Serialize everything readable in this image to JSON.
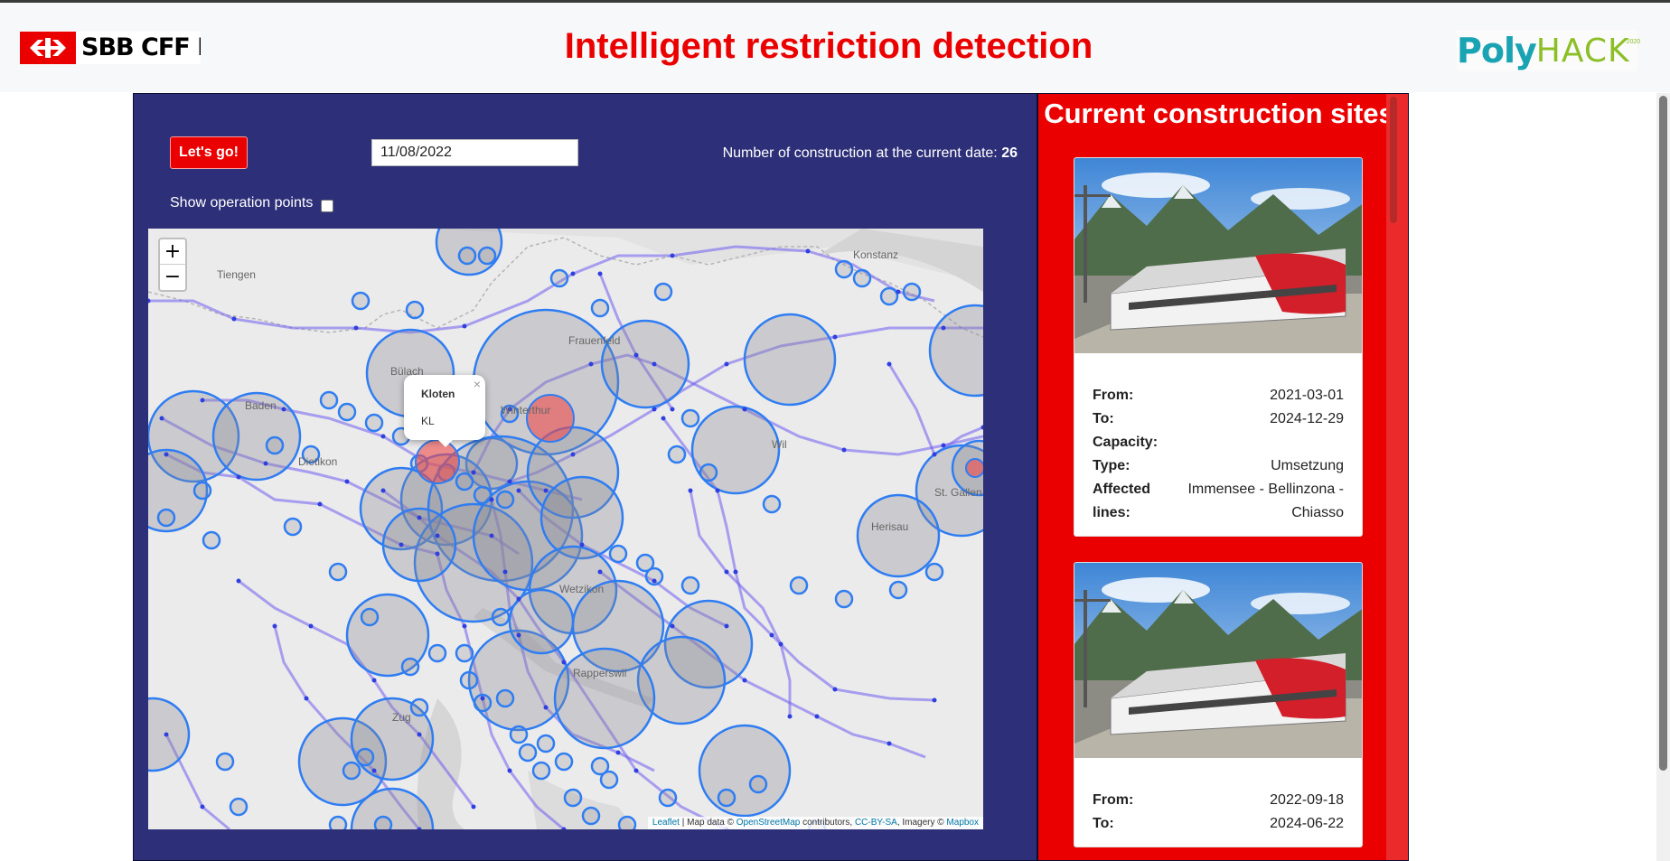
{
  "header": {
    "brand": "SBB CFF FFS",
    "title": "Intelligent restriction detection",
    "partner_logo": {
      "text_a": "Poly",
      "text_b": "HACK",
      "year": "2020"
    }
  },
  "controls": {
    "go_button": "Let's go!",
    "date_value": "11/08/2022",
    "count_label": "Number of construction at the current date:",
    "count_value": "26",
    "show_ops_label": "Show operation points"
  },
  "map": {
    "zoom_in": "+",
    "zoom_out": "−",
    "popup": {
      "close": "×",
      "title": "Kloten",
      "code": "KL"
    },
    "place_labels": [
      "Tiengen",
      "Baden",
      "Winterthur",
      "Frauenfeld",
      "Wil",
      "St. Gallen",
      "Herisau",
      "Wetzikon",
      "Rapperswil",
      "Zug",
      "Konstanz",
      "Bülach",
      "Dietikon"
    ],
    "attribution": {
      "leaflet": "Leaflet",
      "sep1": " | Map data © ",
      "osm": "OpenStreetMap",
      "contributors": " contributors, ",
      "license": "CC-BY-SA",
      "imagery": ", Imagery © ",
      "mapbox": "Mapbox"
    },
    "colors": {
      "circle_fill": "#8a8a95",
      "circle_stroke": "#2f7df2",
      "line": "#6f5cf0",
      "highlight": "#ef4a4a"
    }
  },
  "sidebar": {
    "title": "Current construction sites",
    "cards": [
      {
        "rows": [
          {
            "k": "From:",
            "v": "2021-03-01"
          },
          {
            "k": "To:",
            "v": "2024-12-29"
          },
          {
            "k": "Capacity:",
            "v": ""
          },
          {
            "k": "Type:",
            "v": "Umsetzung"
          },
          {
            "k": "Affected lines:",
            "v": "Immensee - Bellinzona - Chiasso"
          }
        ]
      },
      {
        "rows": [
          {
            "k": "From:",
            "v": "2022-09-18"
          },
          {
            "k": "To:",
            "v": "2024-06-22"
          }
        ]
      }
    ]
  }
}
